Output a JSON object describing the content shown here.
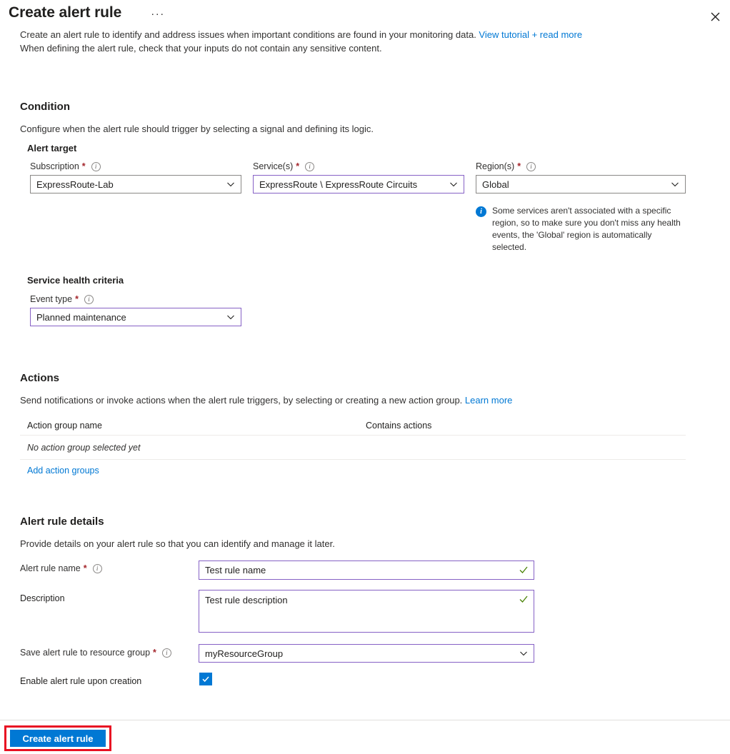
{
  "header": {
    "title": "Create alert rule",
    "more_menu": "···",
    "close_label": "Close"
  },
  "intro": {
    "line1_text": "Create an alert rule to identify and address issues when important conditions are found in your monitoring data. ",
    "line1_link": "View tutorial + read more",
    "line2_text": "When defining the alert rule, check that your inputs do not contain any sensitive content."
  },
  "condition": {
    "heading": "Condition",
    "subtitle": "Configure when the alert rule should trigger by selecting a signal and defining its logic.",
    "alert_target_heading": "Alert target",
    "subscription": {
      "label": "Subscription",
      "required": "*",
      "value": "ExpressRoute-Lab"
    },
    "services": {
      "label": "Service(s)",
      "required": "*",
      "value": "ExpressRoute \\ ExpressRoute Circuits"
    },
    "regions": {
      "label": "Region(s)",
      "required": "*",
      "value": "Global"
    },
    "region_info": "Some services aren't associated with a specific region, so to make sure you don't miss any health events, the 'Global' region is automatically selected.",
    "criteria_heading": "Service health criteria",
    "event_type": {
      "label": "Event type",
      "required": "*",
      "value": "Planned maintenance"
    }
  },
  "actions": {
    "heading": "Actions",
    "subtitle_text": "Send notifications or invoke actions when the alert rule triggers, by selecting or creating a new action group. ",
    "subtitle_link": "Learn more",
    "table": {
      "columns": [
        "Action group name",
        "Contains actions"
      ],
      "empty_text": "No action group selected yet"
    },
    "add_link": "Add action groups"
  },
  "details": {
    "heading": "Alert rule details",
    "subtitle": "Provide details on your alert rule so that you can identify and manage it later.",
    "rule_name": {
      "label": "Alert rule name",
      "required": "*",
      "value": "Test rule name"
    },
    "description": {
      "label": "Description",
      "value": "Test rule description"
    },
    "resource_group": {
      "label": "Save alert rule to resource group",
      "required": "*",
      "value": "myResourceGroup"
    },
    "enable": {
      "label": "Enable alert rule upon creation",
      "checked": true
    }
  },
  "footer": {
    "create_label": "Create alert rule"
  },
  "colors": {
    "accent": "#0078d4",
    "link": "#0078d4",
    "required": "#a4262c",
    "field_focus_border": "#8661c5",
    "field_border": "#8a8886",
    "highlight": "#e81123",
    "valid_check": "#498205"
  }
}
